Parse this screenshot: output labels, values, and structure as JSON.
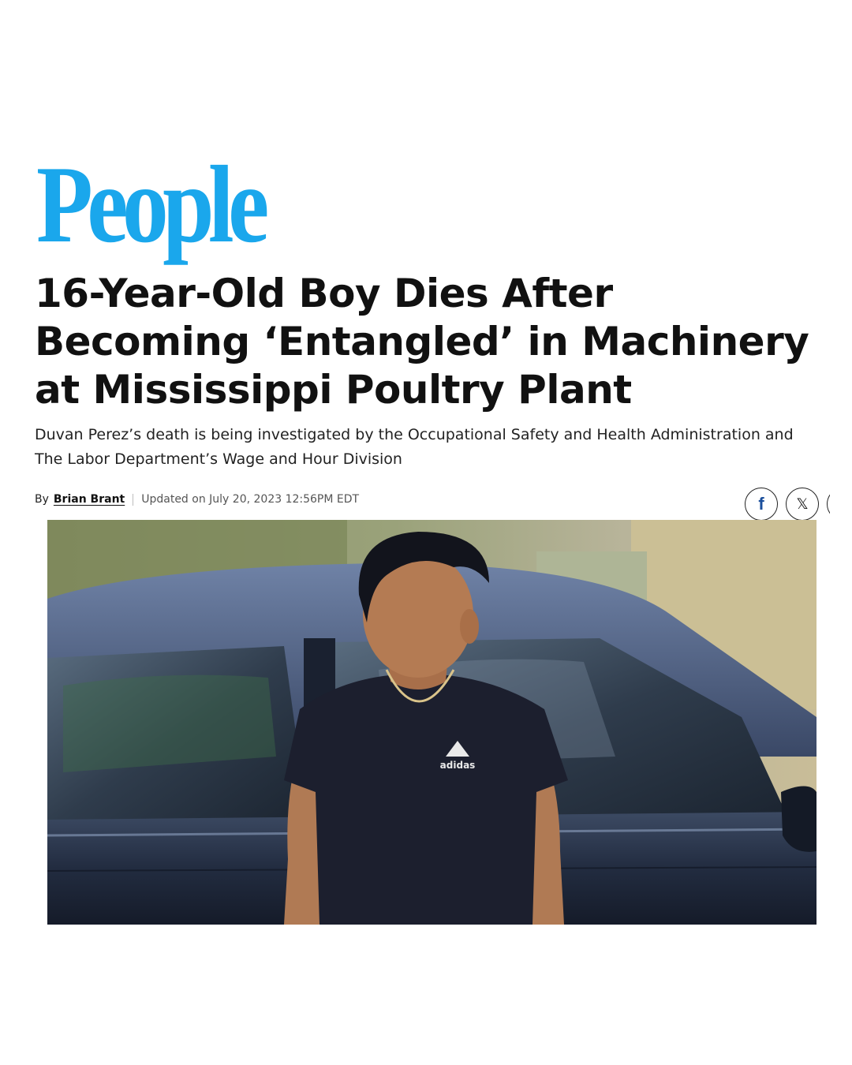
{
  "brand": {
    "name": "People",
    "color": "#1aa7ec"
  },
  "article": {
    "headline": "16-Year-Old Boy Dies After Becoming ‘Entangled’ in Machinery at Mississippi Poultry Plant",
    "dek": "Duvan Perez’s death is being investigated by the Occupational Safety and Health Administration and The Labor Department’s Wage and Hour Division",
    "byline": {
      "prefix": "By",
      "author": "Brian Brant",
      "updated": "Updated on July 20, 2023 12:56PM EDT"
    }
  },
  "share": {
    "buttons": [
      {
        "icon": "facebook-icon",
        "glyph": "f"
      },
      {
        "icon": "x-icon",
        "glyph": "𝕏"
      }
    ]
  },
  "hero_image": {
    "shirt_logo": "adidas"
  }
}
